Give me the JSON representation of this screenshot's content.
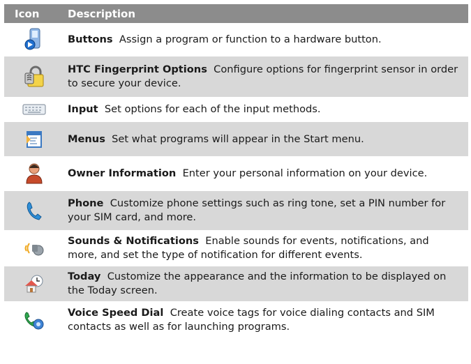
{
  "header": {
    "col_icon": "Icon",
    "col_desc": "Description"
  },
  "rows": [
    {
      "icon": "buttons-icon",
      "title": "Buttons",
      "desc": "Assign a program or function to a hardware button."
    },
    {
      "icon": "lock-icon",
      "title": "HTC Fingerprint Options",
      "desc": "Configure options for fingerprint sensor in order to secure your device."
    },
    {
      "icon": "keyboard-icon",
      "title": "Input",
      "desc": "Set options for each of the input methods."
    },
    {
      "icon": "menu-icon",
      "title": "Menus",
      "desc": "Set what programs will appear in the Start menu."
    },
    {
      "icon": "person-icon",
      "title": "Owner Information",
      "desc": "Enter your personal information on your device."
    },
    {
      "icon": "phone-icon",
      "title": "Phone",
      "desc": "Customize phone settings such as ring tone, set a PIN number for your SIM card, and more."
    },
    {
      "icon": "speaker-icon",
      "title": "Sounds & Notifications",
      "desc": "Enable sounds for events, notifications, and more, and set the type of notification for different events."
    },
    {
      "icon": "today-icon",
      "title": "Today",
      "desc": "Customize the appearance and the information to be displayed on the Today screen."
    },
    {
      "icon": "voice-dial-icon",
      "title": "Voice Speed Dial",
      "desc": "Create voice tags for voice dialing contacts and SIM contacts as well as for launching programs."
    }
  ]
}
